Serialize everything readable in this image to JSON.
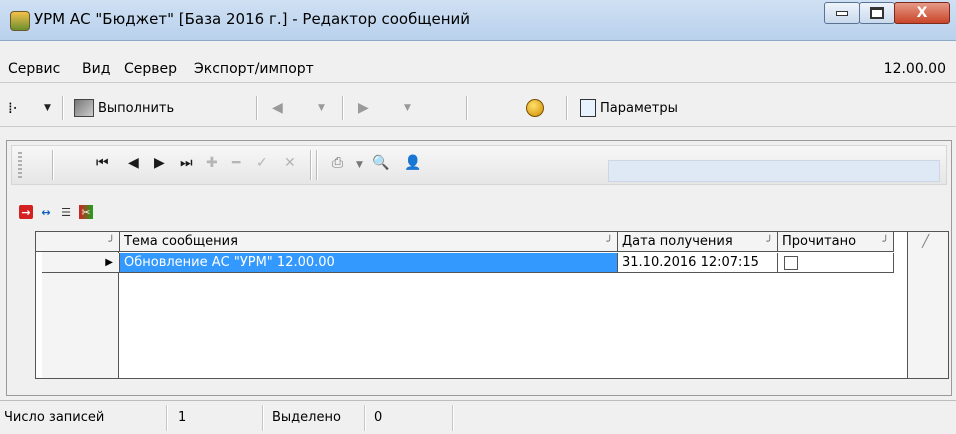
{
  "window": {
    "title": "УРМ АС \"Бюджет\" [База 2016 г.] - Редактор сообщений",
    "controls": {
      "minimize": "",
      "maximize": "",
      "close": "X"
    }
  },
  "menubar": {
    "items": [
      "Сервис",
      "Вид",
      "Сервер",
      "Экспорт/импорт"
    ],
    "version": "12.00.00"
  },
  "toolbar": {
    "execute_label": "Выполнить",
    "params_label": "Параметры"
  },
  "grid": {
    "columns": [
      "Тема сообщения",
      "Дата получения",
      "Прочитано"
    ],
    "rows": [
      {
        "subject": "Обновление АС \"УРМ\" 12.00.00",
        "date": "31.10.2016 12:07:15",
        "read": false
      }
    ]
  },
  "statusbar": {
    "records_label": "Число записей",
    "records_value": "1",
    "selected_label": "Выделено",
    "selected_value": "0"
  },
  "colors": {
    "selection": "#3399ff",
    "selection_text": "#ffffff",
    "title_bar": "#b9d1ec",
    "close_button": "#c9452a"
  }
}
